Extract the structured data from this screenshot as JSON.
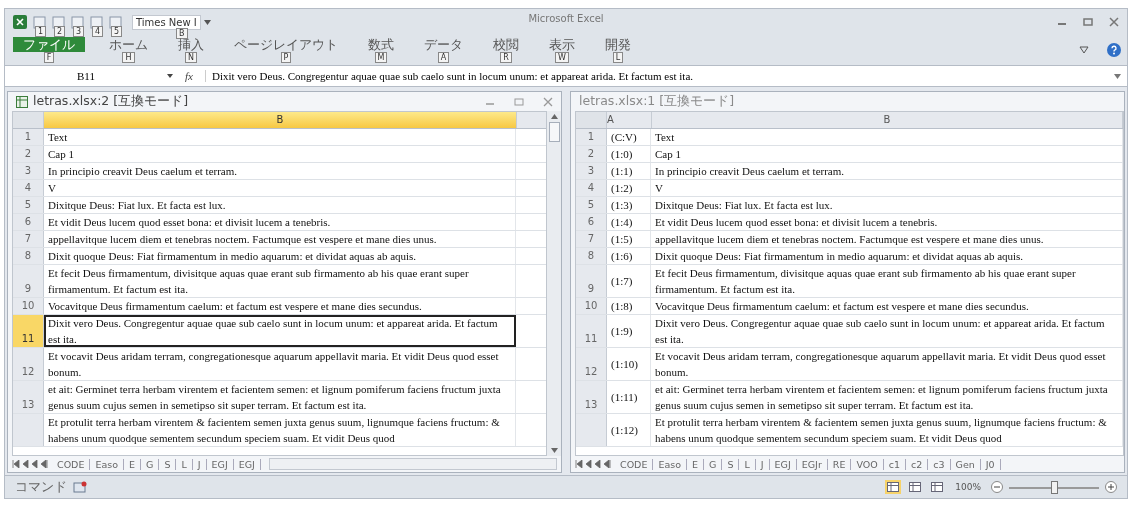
{
  "window": {
    "title": "Microsoft Excel"
  },
  "quick_access": [
    {
      "keytip": "1"
    },
    {
      "keytip": "2"
    },
    {
      "keytip": "3"
    },
    {
      "keytip": "4"
    },
    {
      "keytip": "5"
    }
  ],
  "font_box": {
    "value": "Times New I",
    "keytip": "B"
  },
  "ribbon_tabs": [
    {
      "label": "ファイル",
      "keytip": "F",
      "selected": true
    },
    {
      "label": "ホーム",
      "keytip": "H",
      "selected": false
    },
    {
      "label": "挿入",
      "keytip": "N",
      "selected": false
    },
    {
      "label": "ページレイアウト",
      "keytip": "P",
      "selected": false
    },
    {
      "label": "数式",
      "keytip": "M",
      "selected": false
    },
    {
      "label": "データ",
      "keytip": "A",
      "selected": false
    },
    {
      "label": "校閲",
      "keytip": "R",
      "selected": false
    },
    {
      "label": "表示",
      "keytip": "W",
      "selected": false
    },
    {
      "label": "開発",
      "keytip": "L",
      "selected": false
    }
  ],
  "formula_bar": {
    "name_box": "B11",
    "function_label": "fx",
    "formula": "Dixit vero Deus. Congregentur aquae quae sub caelo sunt in locum unum: et appareat arida. Et factum est ita."
  },
  "panes": [
    {
      "title": "letras.xlsx:2 [互換モード]",
      "kind": "active",
      "columns": [
        {
          "label": "B",
          "selected": true
        }
      ],
      "rows": [
        {
          "number": "1",
          "selected": false,
          "cells": [
            "Text"
          ]
        },
        {
          "number": "2",
          "selected": false,
          "cells": [
            "Cap 1"
          ]
        },
        {
          "number": "3",
          "selected": false,
          "cells": [
            "In principio creavit Deus caelum et terram."
          ]
        },
        {
          "number": "4",
          "selected": false,
          "cells": [
            "V"
          ]
        },
        {
          "number": "5",
          "selected": false,
          "cells": [
            "Dixitque Deus: Fiat lux. Et facta est lux."
          ]
        },
        {
          "number": "6",
          "selected": false,
          "cells": [
            "Et vidit Deus lucem quod esset bona: et divisit lucem a tenebris."
          ]
        },
        {
          "number": "7",
          "selected": false,
          "cells": [
            "appellavitque lucem diem et tenebras noctem. Factumque est vespere et mane dies unus."
          ]
        },
        {
          "number": "8",
          "selected": false,
          "cells": [
            "Dixit quoque Deus: Fiat firmamentum in medio aquarum: et dividat aquas ab aquis."
          ]
        },
        {
          "number": "9",
          "selected": false,
          "cells": [
            "Et fecit Deus firmamentum, divisitque aquas quae erant sub firmamento ab his quae erant super firmamentum. Et factum est ita."
          ]
        },
        {
          "number": "10",
          "selected": false,
          "cells": [
            "Vocavitque Deus firmamentum caelum: et factum est vespere et mane dies secundus."
          ]
        },
        {
          "number": "11",
          "selected": true,
          "cells": [
            "Dixit vero Deus. Congregentur aquae quae sub caelo sunt in locum unum: et appareat arida. Et factum est ita."
          ]
        },
        {
          "number": "12",
          "selected": false,
          "cells": [
            "Et vocavit Deus aridam terram, congregationesque aquarum appellavit maria. Et vidit Deus quod esset bonum."
          ]
        },
        {
          "number": "13",
          "selected": false,
          "cells": [
            "et ait: Germinet terra herbam virentem et facientem semen: et lignum pomiferum faciens fructum juxta genus suum cujus semen in semetipso sit super terram. Et factum est ita."
          ]
        },
        {
          "number": "",
          "selected": false,
          "cells": [
            "Et protulit terra herbam virentem & facientem semen juxta genus suum, lignumque faciens fructum: & habens unum quodque sementem secundum speciem suam. Et vidit Deus quod"
          ]
        }
      ],
      "sheet_tabs": [
        "CODE",
        "Easo",
        "E",
        "G",
        "S",
        "L",
        "J",
        "EGJ",
        "EGJ"
      ]
    },
    {
      "title": "letras.xlsx:1 [互換モード]",
      "kind": "inactive",
      "columns": [
        {
          "label": "A",
          "selected": false
        },
        {
          "label": "B",
          "selected": false
        }
      ],
      "rows": [
        {
          "number": "1",
          "selected": false,
          "cells": [
            "(C:V)",
            "Text"
          ]
        },
        {
          "number": "2",
          "selected": false,
          "cells": [
            "(1:0)",
            "Cap 1"
          ]
        },
        {
          "number": "3",
          "selected": false,
          "cells": [
            "(1:1)",
            "In principio creavit Deus caelum et terram."
          ]
        },
        {
          "number": "4",
          "selected": false,
          "cells": [
            "(1:2)",
            "V"
          ]
        },
        {
          "number": "5",
          "selected": false,
          "cells": [
            "(1:3)",
            "Dixitque Deus: Fiat lux. Et facta est lux."
          ]
        },
        {
          "number": "6",
          "selected": false,
          "cells": [
            "(1:4)",
            "Et vidit Deus lucem quod esset bona: et divisit lucem a tenebris."
          ]
        },
        {
          "number": "7",
          "selected": false,
          "cells": [
            "(1:5)",
            "appellavitque lucem diem et tenebras noctem. Factumque est vespere et mane dies unus."
          ]
        },
        {
          "number": "8",
          "selected": false,
          "cells": [
            "(1:6)",
            "Dixit quoque Deus: Fiat firmamentum in medio aquarum: et dividat aquas ab aquis."
          ]
        },
        {
          "number": "9",
          "selected": false,
          "cells": [
            "(1:7)",
            "Et fecit Deus firmamentum, divisitque aquas quae erant sub firmamento ab his quae erant super firmamentum. Et factum est ita."
          ]
        },
        {
          "number": "10",
          "selected": false,
          "cells": [
            "(1:8)",
            "Vocavitque Deus firmamentum caelum: et factum est vespere et mane dies secundus."
          ]
        },
        {
          "number": "11",
          "selected": false,
          "cells": [
            "(1:9)",
            "Dixit vero Deus. Congregentur aquae quae sub caelo sunt in locum unum: et appareat arida. Et factum est ita."
          ]
        },
        {
          "number": "12",
          "selected": false,
          "cells": [
            "(1:10)",
            "Et vocavit Deus aridam terram, congregationesque aquarum appellavit maria. Et vidit Deus quod esset bonum."
          ]
        },
        {
          "number": "13",
          "selected": false,
          "cells": [
            "(1:11)",
            "et ait: Germinet terra herbam virentem et facientem semen: et lignum pomiferum faciens fructum juxta genus suum cujus semen in semetipso sit super terram. Et factum est ita."
          ]
        },
        {
          "number": "",
          "selected": false,
          "cells": [
            "(1:12)",
            "Et protulit terra herbam virentem & facientem semen juxta genus suum, lignumque faciens fructum: & habens unum quodque sementem secundum speciem suam. Et vidit Deus quod"
          ]
        }
      ],
      "sheet_tabs": [
        "CODE",
        "Easo",
        "E",
        "G",
        "S",
        "L",
        "J",
        "EGJ",
        "EGJr",
        "RE",
        "VOO",
        "c1",
        "c2",
        "c3",
        "Gen",
        "J0"
      ]
    }
  ],
  "status_bar": {
    "mode": "コマンド",
    "views": [
      {
        "selected": true
      },
      {
        "selected": false
      },
      {
        "selected": false
      }
    ],
    "zoom": "100%",
    "zoom_slider": {
      "level": 0.5
    }
  }
}
